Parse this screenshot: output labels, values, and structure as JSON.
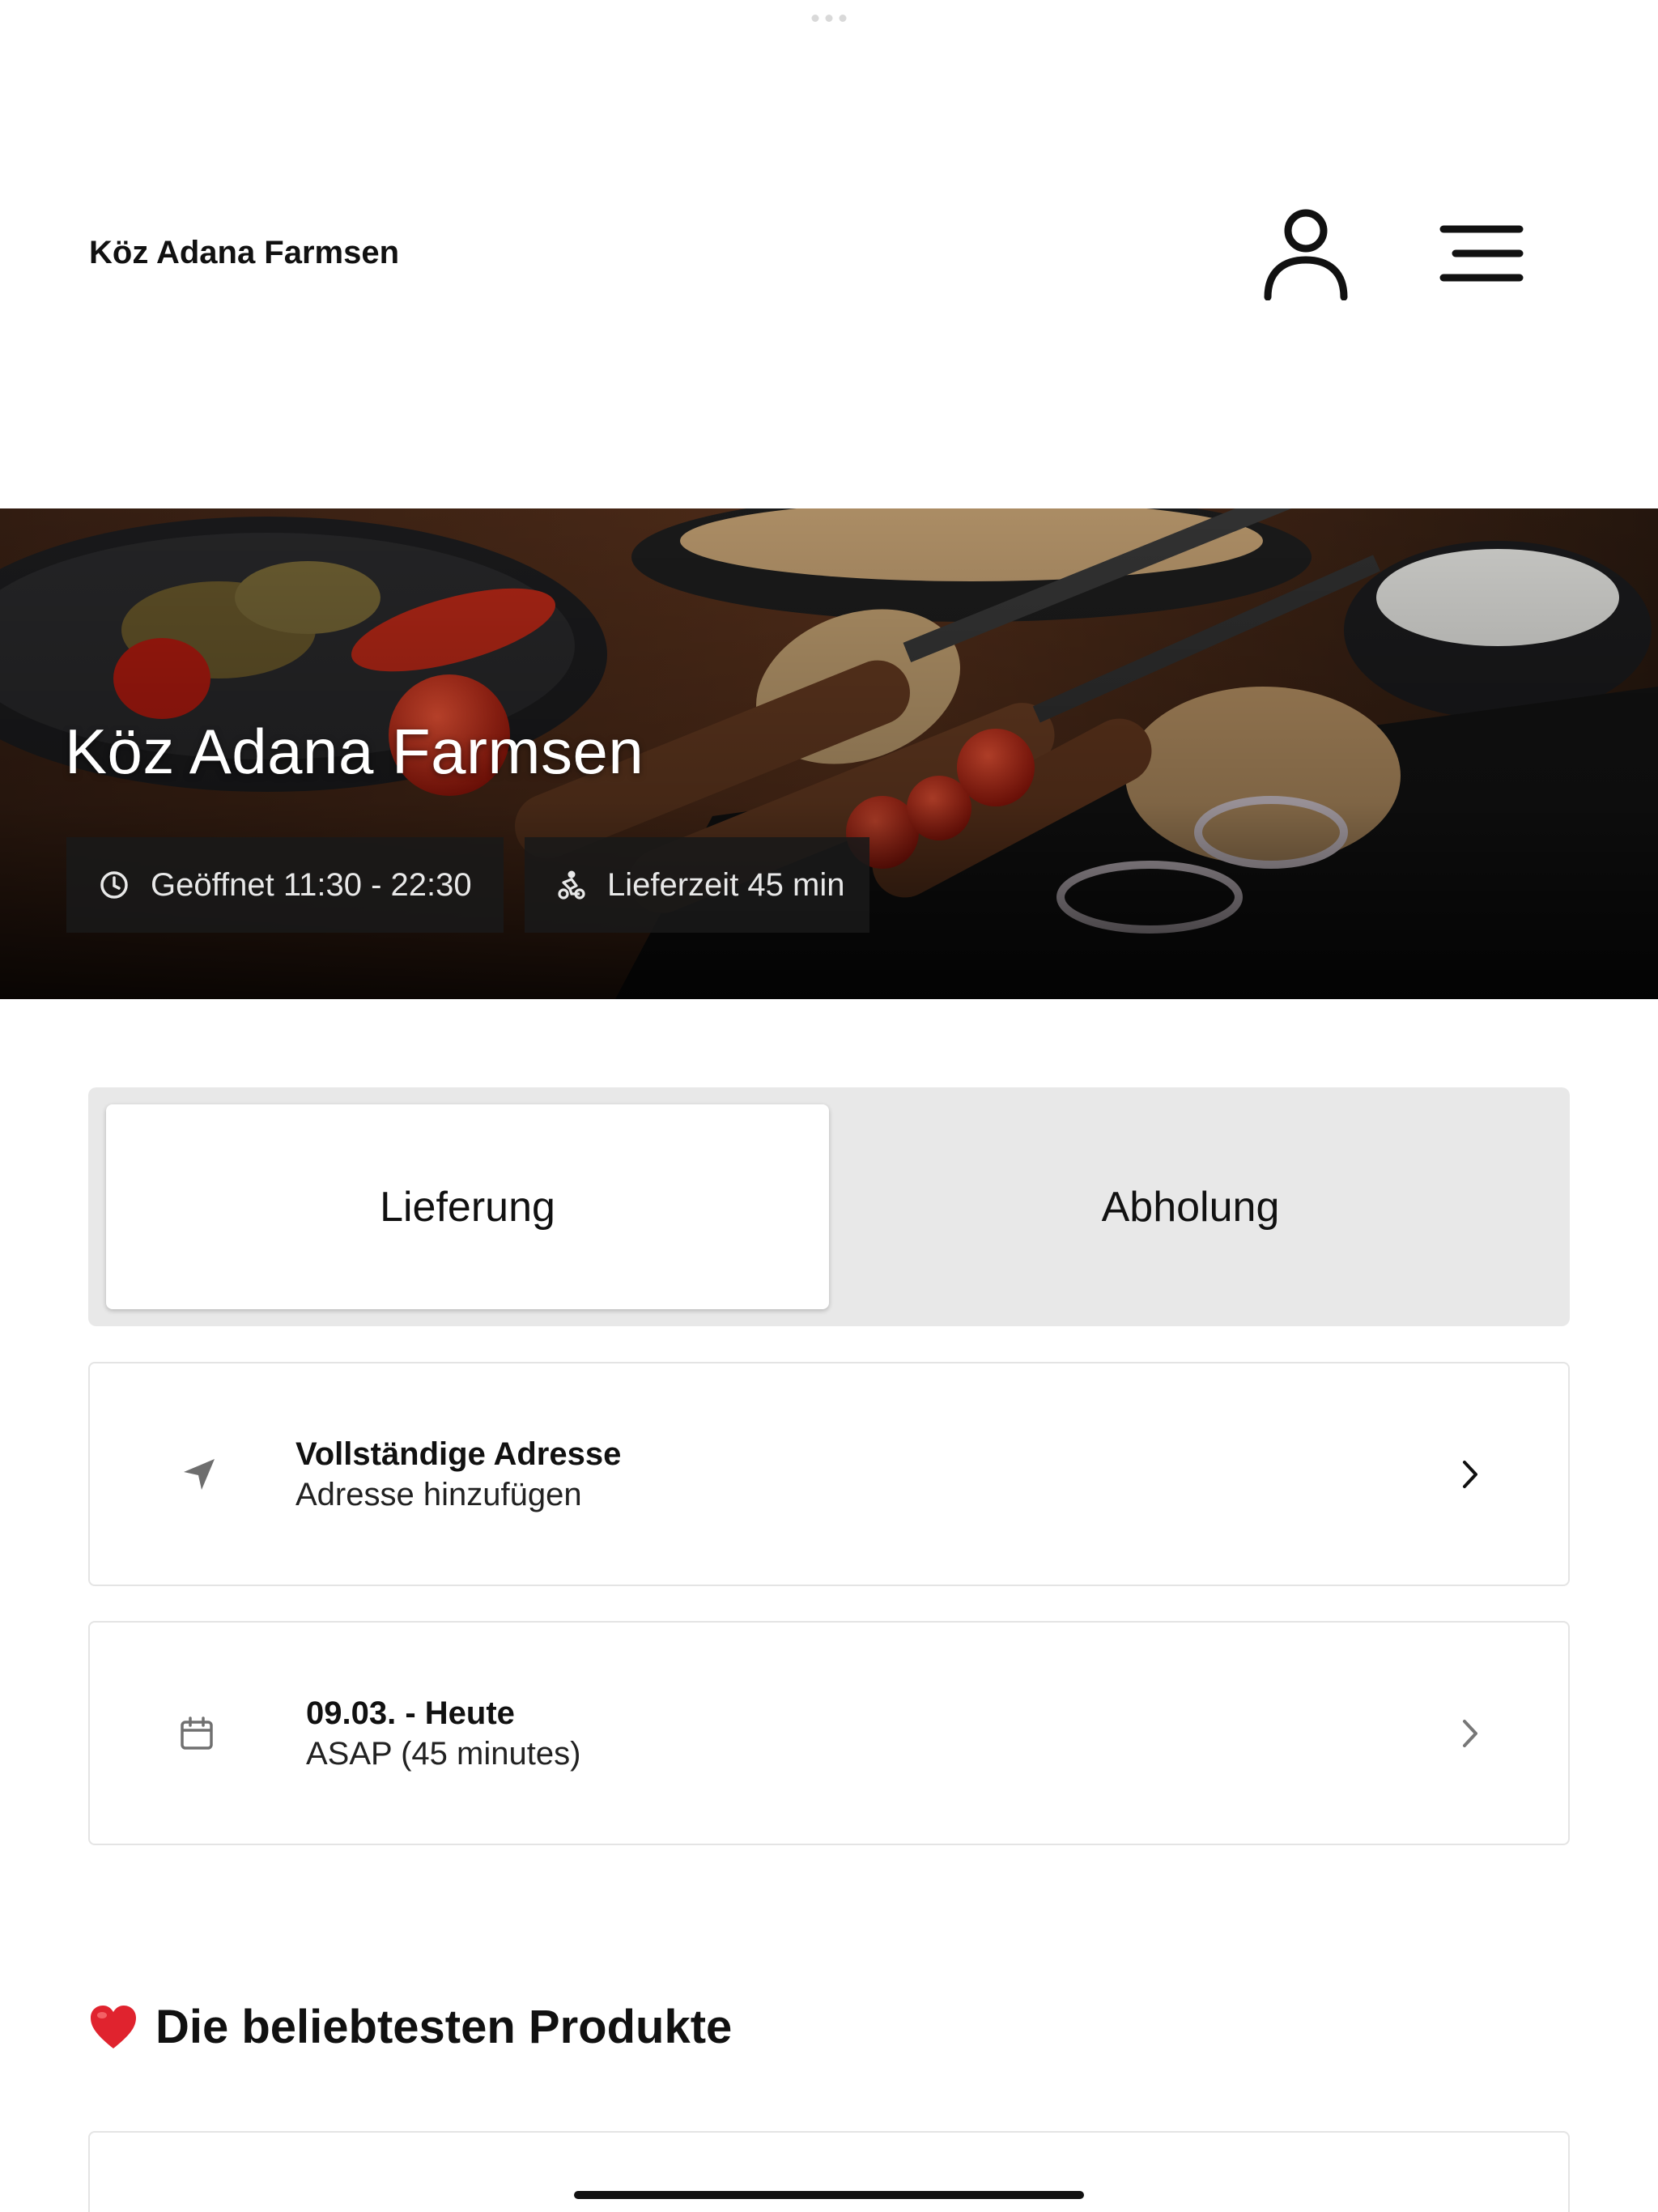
{
  "header": {
    "brand": "Köz Adana Farmsen",
    "user_icon": "user-icon",
    "menu_icon": "menu-icon"
  },
  "hero": {
    "title": "Köz Adana Farmsen",
    "opening_hours": "Geöffnet 11:30 - 22:30",
    "delivery_time": "Lieferzeit 45 min",
    "clock_icon": "clock-icon",
    "delivery_icon": "scooter-icon"
  },
  "order_type": {
    "options": [
      "Lieferung",
      "Abholung"
    ],
    "selected": "Lieferung"
  },
  "address_card": {
    "icon": "navigation-arrow-icon",
    "title": "Vollständige Adresse",
    "subtitle": "Adresse hinzufügen"
  },
  "date_card": {
    "icon": "calendar-icon",
    "title": "09.03. - Heute",
    "subtitle": "ASAP (45 minutes)"
  },
  "popular": {
    "emoji": "❤️",
    "title": "Die beliebtesten Produkte"
  },
  "colors": {
    "text": "#111111",
    "toggle_bg": "#e8e8e8",
    "border": "#e4e4e4",
    "chip_bg": "#191919",
    "heart": "#e0232e"
  }
}
